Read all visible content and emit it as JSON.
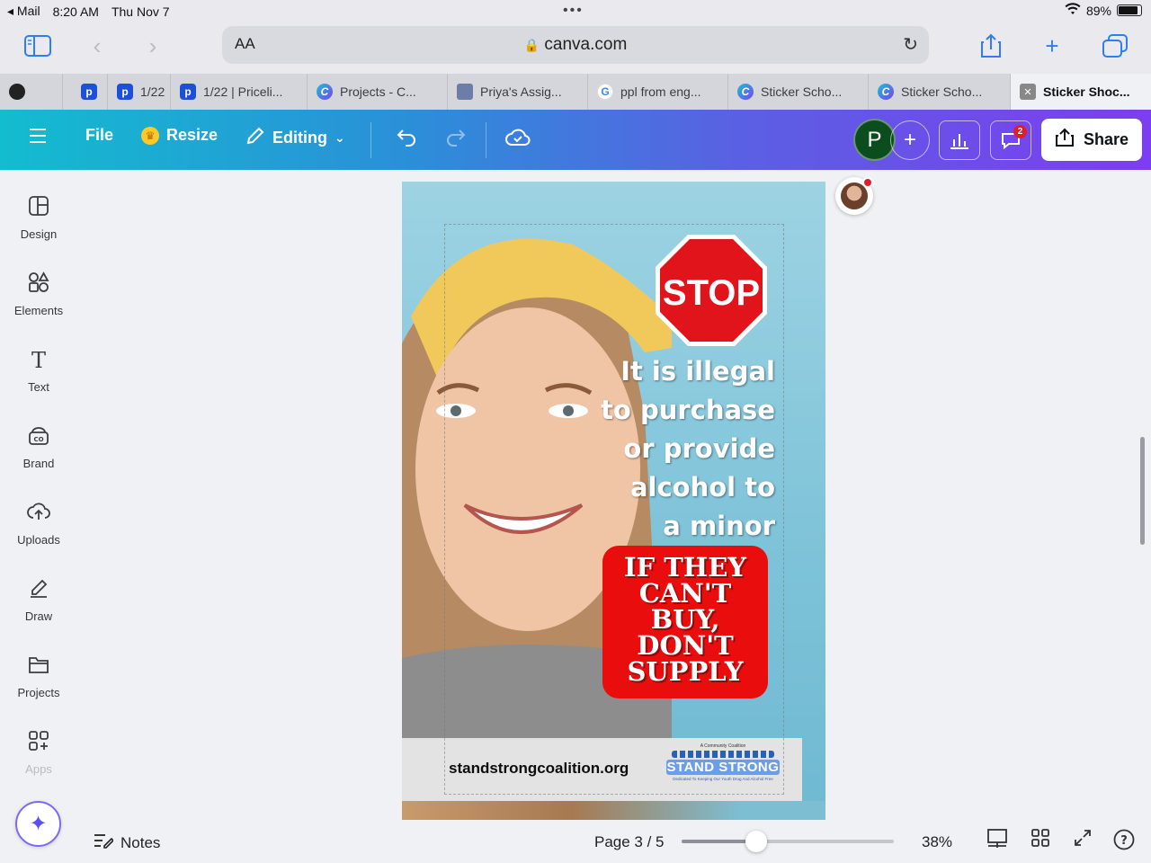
{
  "status": {
    "back_app": "Mail",
    "time": "8:20 AM",
    "date": "Thu Nov 7",
    "battery": "89%",
    "battery_level": 0.89
  },
  "browser": {
    "text_size": "AA",
    "url": "canva.com"
  },
  "tabs": [
    {
      "icon": "p",
      "label": ""
    },
    {
      "icon": "p",
      "label": "1/22"
    },
    {
      "icon": "p",
      "label": "1/22 | Priceli..."
    },
    {
      "icon": "canva",
      "label": "Projects - C..."
    },
    {
      "icon": "slides",
      "label": "Priya's Assig..."
    },
    {
      "icon": "google",
      "label": "ppl from eng..."
    },
    {
      "icon": "canva",
      "label": "Sticker Scho..."
    },
    {
      "icon": "canva",
      "label": "Sticker Scho..."
    },
    {
      "icon": "close",
      "label": "Sticker Shoc..."
    }
  ],
  "canva_header": {
    "file": "File",
    "resize": "Resize",
    "editing": "Editing",
    "avatar_initial": "P",
    "comments_badge": "2",
    "share": "Share"
  },
  "sidebar": {
    "items": [
      {
        "label": "Design"
      },
      {
        "label": "Elements"
      },
      {
        "label": "Text"
      },
      {
        "label": "Brand"
      },
      {
        "label": "Uploads"
      },
      {
        "label": "Draw"
      },
      {
        "label": "Projects"
      },
      {
        "label": "Apps"
      }
    ]
  },
  "poster": {
    "stop_sign": "STOP",
    "message_lines": [
      "It is illegal",
      "to purchase",
      "or provide",
      "alcohol to",
      "a minor"
    ],
    "slogan_lines": [
      "IF THEY",
      "CAN'T",
      "BUY,",
      "DON'T",
      "SUPPLY"
    ],
    "website": "standstrongcoalition.org",
    "logo": {
      "tagline_top": "A Community Coalition",
      "name": "STAND STRONG",
      "tagline_bottom": "Dedicated To Keeping Our Youth Drug And Alcohol Free"
    }
  },
  "bottom_bar": {
    "notes": "Notes",
    "page_indicator": "Page 3 / 5",
    "zoom": "38%",
    "zoom_fraction": 0.35
  },
  "colors": {
    "accent_purple": "#7d3df0",
    "accent_teal": "#13bccf",
    "stop_red": "#e90d0d"
  }
}
